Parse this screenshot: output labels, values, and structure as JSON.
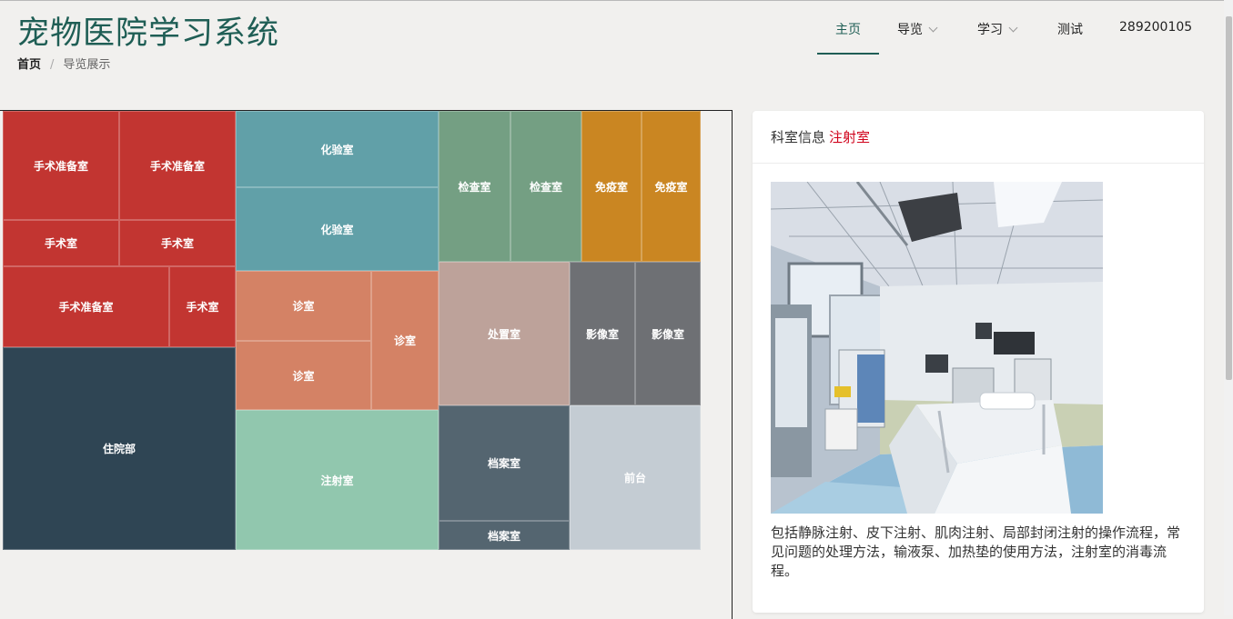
{
  "header": {
    "title": "宠物医院学习系统",
    "breadcrumb": {
      "home": "首页",
      "separator": "/",
      "current": "导览展示"
    }
  },
  "nav": {
    "items": [
      {
        "label": "主页",
        "active": true
      },
      {
        "label": "导览",
        "dropdown": true
      },
      {
        "label": "学习",
        "dropdown": true
      },
      {
        "label": "测试"
      },
      {
        "label": "289200105"
      }
    ]
  },
  "treemap": {
    "cells": [
      {
        "label": "手术准备室",
        "color": "#c23531"
      },
      {
        "label": "手术准备室",
        "color": "#c23531"
      },
      {
        "label": "手术室",
        "color": "#c23531"
      },
      {
        "label": "手术室",
        "color": "#c23531"
      },
      {
        "label": "手术准备室",
        "color": "#c23531"
      },
      {
        "label": "手术室",
        "color": "#c23531"
      },
      {
        "label": "住院部",
        "color": "#2f4554"
      },
      {
        "label": "化验室",
        "color": "#61a0a8"
      },
      {
        "label": "化验室",
        "color": "#61a0a8"
      },
      {
        "label": "诊室",
        "color": "#d48265"
      },
      {
        "label": "诊室",
        "color": "#d48265"
      },
      {
        "label": "诊室",
        "color": "#d48265"
      },
      {
        "label": "注射室",
        "color": "#91c7ae"
      },
      {
        "label": "检查室",
        "color": "#749f83"
      },
      {
        "label": "检查室",
        "color": "#749f83"
      },
      {
        "label": "免疫室",
        "color": "#ca8622"
      },
      {
        "label": "免疫室",
        "color": "#ca8622"
      },
      {
        "label": "处置室",
        "color": "#bda29a"
      },
      {
        "label": "影像室",
        "color": "#6e7074"
      },
      {
        "label": "影像室",
        "color": "#6e7074"
      },
      {
        "label": "档案室",
        "color": "#546570"
      },
      {
        "label": "档案室",
        "color": "#546570"
      },
      {
        "label": "前台",
        "color": "#c4ccd3"
      }
    ]
  },
  "info": {
    "label": "科室信息",
    "room": "注射室",
    "description": "包括静脉注射、皮下注射、肌肉注射、局部封闭注射的操作流程，常见问题的处理方法，输液泵、加热垫的使用方法，注射室的消毒流程。"
  }
}
